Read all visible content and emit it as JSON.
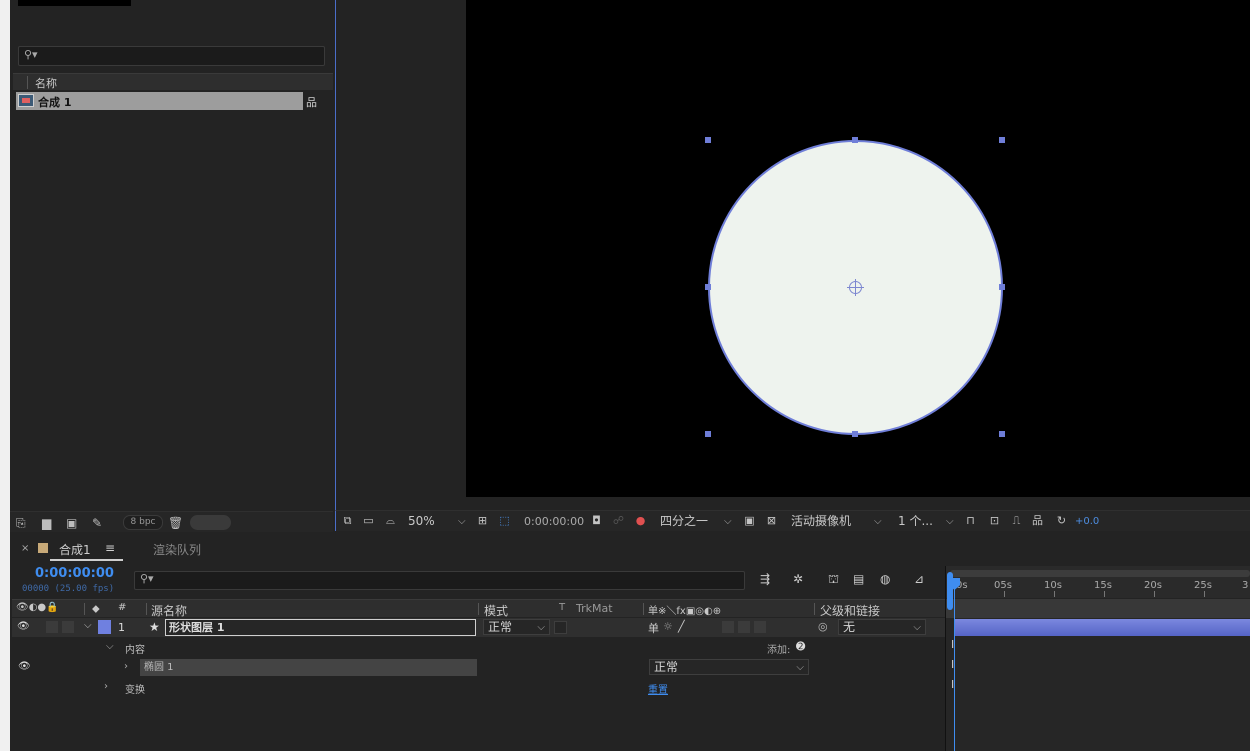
{
  "project": {
    "search_placeholder": "",
    "column_name": "名称",
    "items": [
      {
        "name": "合成 1"
      }
    ],
    "bpc": "8 bpc"
  },
  "viewer": {
    "zoom": "50%",
    "timecode": "0:00:00:00",
    "resolution": "四分之一",
    "camera": "活动摄像机",
    "views": "1 个...",
    "exposure": "+0.0"
  },
  "timeline": {
    "tab_comp": "合成1",
    "tab_menu": "≡",
    "tab_render": "渲染队列",
    "timecode": "0:00:00:00",
    "fps": "00000 (25.00 fps)",
    "ruler": [
      "0s",
      "05s",
      "10s",
      "15s",
      "20s",
      "25s",
      "3"
    ],
    "columns": {
      "num": "#",
      "source": "源名称",
      "mode": "模式",
      "t": "T",
      "trkmat": "TrkMat",
      "switches": "单※＼fx▣◎◐⊕",
      "parent": "父级和链接"
    },
    "layer": {
      "index": "1",
      "name": "形状图层 1",
      "mode": "正常",
      "parent": "无"
    },
    "contents_label": "内容",
    "add_label": "添加:",
    "ellipse_label": "椭圆 1",
    "ellipse_mode": "正常",
    "transform_label": "变换",
    "reset_label": "重置"
  },
  "colors": {
    "accent": "#3f8df0",
    "layer_label": "#6f80e0",
    "shape_fill": "#eef3ee",
    "shape_stroke": "#6f7ed8"
  }
}
